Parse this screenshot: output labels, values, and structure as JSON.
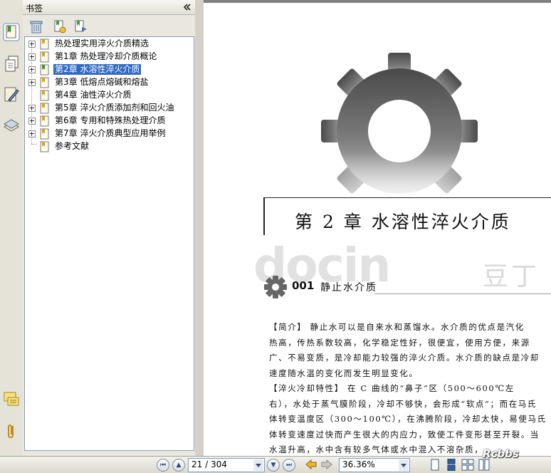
{
  "panel": {
    "title": "书签",
    "collapse_icon": "double-chevron-left-icon",
    "toolbar": [
      "trash-icon",
      "new-bookmark-icon",
      "expand-bookmark-icon"
    ]
  },
  "side_strip": [
    "bookmarks-icon",
    "pages-icon",
    "annotations-icon",
    "layers-icon",
    "comments-icon",
    "attachments-icon"
  ],
  "bookmarks": [
    {
      "label": "热处理实用淬火介质精选",
      "expandable": true
    },
    {
      "label": "第1章  热处理冷却介质概论",
      "expandable": true
    },
    {
      "label": "第2章  水溶性淬火介质",
      "expandable": true,
      "selected": true
    },
    {
      "label": "第3章  低熔点熔碱和熔盐",
      "expandable": true
    },
    {
      "label": "第4章  油性淬火介质",
      "expandable": false
    },
    {
      "label": "第5章  淬火介质添加剂和回火油",
      "expandable": true
    },
    {
      "label": "第6章  专用和特殊热处理介质",
      "expandable": true
    },
    {
      "label": "第7章  淬火介质典型应用举例",
      "expandable": true
    },
    {
      "label": "参考文献",
      "expandable": false
    }
  ],
  "document": {
    "chapter_title": "第 2 章   水溶性淬火介质",
    "section_number": "001",
    "section_title": "静止水介质",
    "body_lines": [
      "【简介】 静止水可以是自来水和蒸馏水。水介质的优点是汽化",
      "热高，传热系数较高，化学稳定性好，很便宜，使用方便，来源",
      "广、不易变质，是冷却能力较强的淬火介质。水介质的缺点是冷却",
      "速度随水温的变化而发生明显变化。",
      "【淬火冷却特性】 在 C 曲线的“鼻子”区（500～600℃左",
      "右），水处于蒸气膜阶段，冷却不够快，会形成“软点”；而在马氏",
      "体转变温度区（300～100℃），在沸腾阶段，冷却太快，易使马氏",
      "体转变速度过快而产生很大的内应力，致使工件变形甚至开裂。当",
      "水温升高，水中含有较多气体或水中混入不溶杂质，"
    ],
    "watermark": "docin",
    "watermark_cn": "豆丁"
  },
  "statusbar": {
    "page": "21 / 304",
    "zoom": "36.36%",
    "brand": "Rcbbs"
  }
}
